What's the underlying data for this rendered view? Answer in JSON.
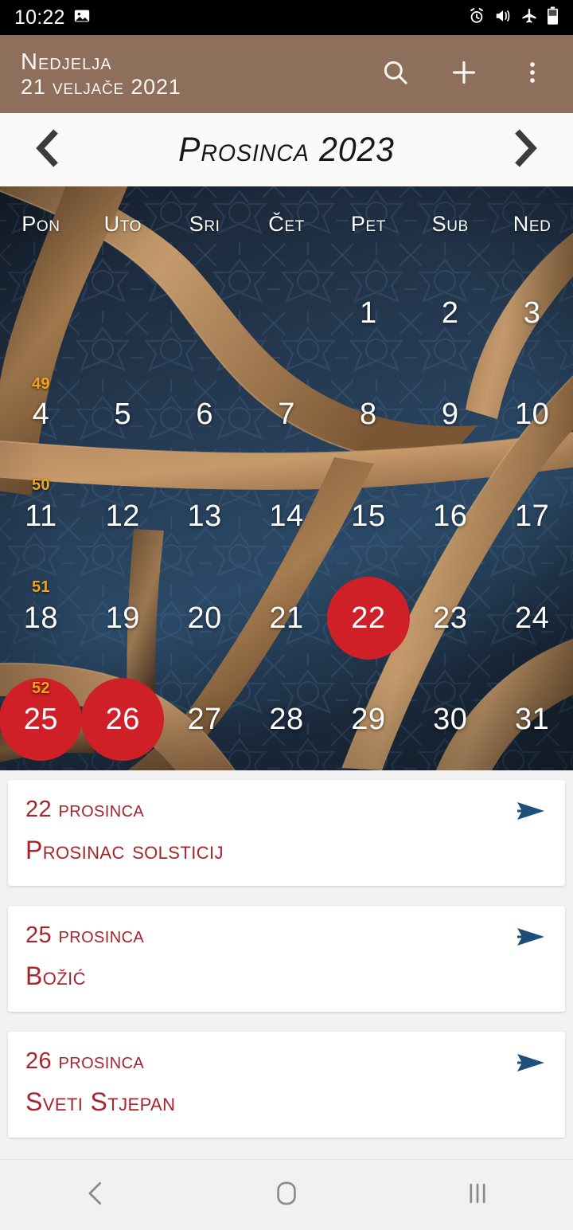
{
  "statusbar": {
    "clock": "10:22",
    "icons": [
      "image-icon",
      "alarm-icon",
      "mute-vibrate-icon",
      "airplane-mode-icon",
      "battery-icon"
    ]
  },
  "toolbar": {
    "weekday": "Nedjelja",
    "date": "21 veljače 2021",
    "accent_color": "#8e6f5c",
    "actions": [
      "search-icon",
      "add-icon",
      "overflow-menu-icon"
    ]
  },
  "month_nav": {
    "prev_label": "‹",
    "title": "Prosinca 2023",
    "next_label": "›"
  },
  "calendar": {
    "weekday_headers": [
      "Pon",
      "Uto",
      "Sri",
      "Čet",
      "Pet",
      "Sub",
      "Ned"
    ],
    "highlight_color": "#ce2026",
    "weeknum_color": "#f2a31a",
    "weeks": [
      {
        "week_number": "",
        "days": [
          {
            "n": "",
            "empty": true,
            "marked": false
          },
          {
            "n": "",
            "empty": true,
            "marked": false
          },
          {
            "n": "",
            "empty": true,
            "marked": false
          },
          {
            "n": "",
            "empty": true,
            "marked": false
          },
          {
            "n": "1",
            "empty": false,
            "marked": false
          },
          {
            "n": "2",
            "empty": false,
            "marked": false
          },
          {
            "n": "3",
            "empty": false,
            "marked": false
          }
        ]
      },
      {
        "week_number": "49",
        "days": [
          {
            "n": "4",
            "empty": false,
            "marked": false
          },
          {
            "n": "5",
            "empty": false,
            "marked": false
          },
          {
            "n": "6",
            "empty": false,
            "marked": false
          },
          {
            "n": "7",
            "empty": false,
            "marked": false
          },
          {
            "n": "8",
            "empty": false,
            "marked": false
          },
          {
            "n": "9",
            "empty": false,
            "marked": false
          },
          {
            "n": "10",
            "empty": false,
            "marked": false
          }
        ]
      },
      {
        "week_number": "50",
        "days": [
          {
            "n": "11",
            "empty": false,
            "marked": false
          },
          {
            "n": "12",
            "empty": false,
            "marked": false
          },
          {
            "n": "13",
            "empty": false,
            "marked": false
          },
          {
            "n": "14",
            "empty": false,
            "marked": false
          },
          {
            "n": "15",
            "empty": false,
            "marked": false
          },
          {
            "n": "16",
            "empty": false,
            "marked": false
          },
          {
            "n": "17",
            "empty": false,
            "marked": false
          }
        ]
      },
      {
        "week_number": "51",
        "days": [
          {
            "n": "18",
            "empty": false,
            "marked": false
          },
          {
            "n": "19",
            "empty": false,
            "marked": false
          },
          {
            "n": "20",
            "empty": false,
            "marked": false
          },
          {
            "n": "21",
            "empty": false,
            "marked": false
          },
          {
            "n": "22",
            "empty": false,
            "marked": true
          },
          {
            "n": "23",
            "empty": false,
            "marked": false
          },
          {
            "n": "24",
            "empty": false,
            "marked": false
          }
        ]
      },
      {
        "week_number": "52",
        "days": [
          {
            "n": "25",
            "empty": false,
            "marked": true
          },
          {
            "n": "26",
            "empty": false,
            "marked": true
          },
          {
            "n": "27",
            "empty": false,
            "marked": false
          },
          {
            "n": "28",
            "empty": false,
            "marked": false
          },
          {
            "n": "29",
            "empty": false,
            "marked": false
          },
          {
            "n": "30",
            "empty": false,
            "marked": false
          },
          {
            "n": "31",
            "empty": false,
            "marked": false
          }
        ]
      }
    ]
  },
  "events": {
    "text_color": "#a8242a",
    "arrow_color": "#1f4e79",
    "items": [
      {
        "date": "22 prosinca",
        "title": "Prosinac solsticij",
        "arrow": "send-arrow-icon"
      },
      {
        "date": "25 prosinca",
        "title": "Božić",
        "arrow": "send-arrow-icon"
      },
      {
        "date": "26 prosinca",
        "title": "Sveti Stjepan",
        "arrow": "send-arrow-icon"
      }
    ]
  },
  "navbar": {
    "back": "back-nav-icon",
    "home": "home-nav-icon",
    "recents": "recents-nav-icon"
  }
}
